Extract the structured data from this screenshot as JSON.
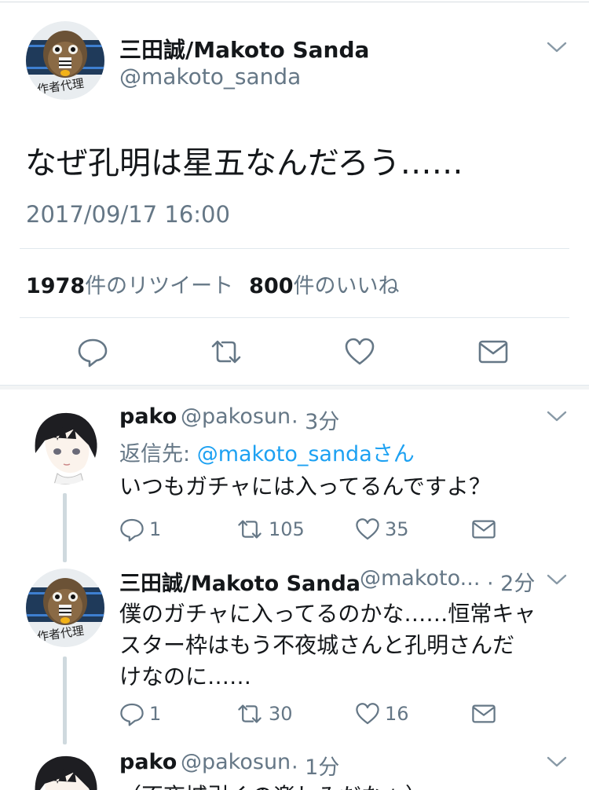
{
  "main_tweet": {
    "author_name": "三田誠/Makoto Sanda",
    "author_handle": "@makoto_sanda",
    "text": "なぜ孔明は星五なんだろう……",
    "timestamp": "2017/09/17 16:00",
    "retweet_count": "1978",
    "retweet_label": "件のリツイート",
    "like_count": "800",
    "like_label": "件のいいね",
    "avatar_caption": "作者代理"
  },
  "replies": [
    {
      "author_name": "pako",
      "author_handle": "@pakosun",
      "time": "· 3分",
      "reply_to_prefix": "返信先: ",
      "reply_to_link": "@makoto_sandaさん",
      "text": "いつもガチャには入ってるんですよ？",
      "reply_count": "1",
      "retweet_count": "105",
      "like_count": "35"
    },
    {
      "author_name": "三田誠/Makoto Sanda",
      "author_handle": "@makoto...",
      "time": "· 2分",
      "text_lines": [
        "僕のガチャに入ってるのかな……恒常キャ",
        "スター枠はもう不夜城さんと孔明さんだ",
        "けなのに……"
      ],
      "reply_count": "1",
      "retweet_count": "30",
      "like_count": "16",
      "avatar_caption": "作者代理"
    },
    {
      "author_name": "pako",
      "author_handle": "@pakosun",
      "time": "· 1分",
      "text": "（不夜城引くの楽しみだなぁ）"
    }
  ],
  "icons": {
    "reply": "reply-icon",
    "retweet": "retweet-icon",
    "like": "heart-icon",
    "share": "envelope-icon",
    "menu": "chevron-down-icon"
  },
  "colors": {
    "accent": "#1da1f2",
    "icon_gray": "#657786",
    "text": "#14171a"
  }
}
